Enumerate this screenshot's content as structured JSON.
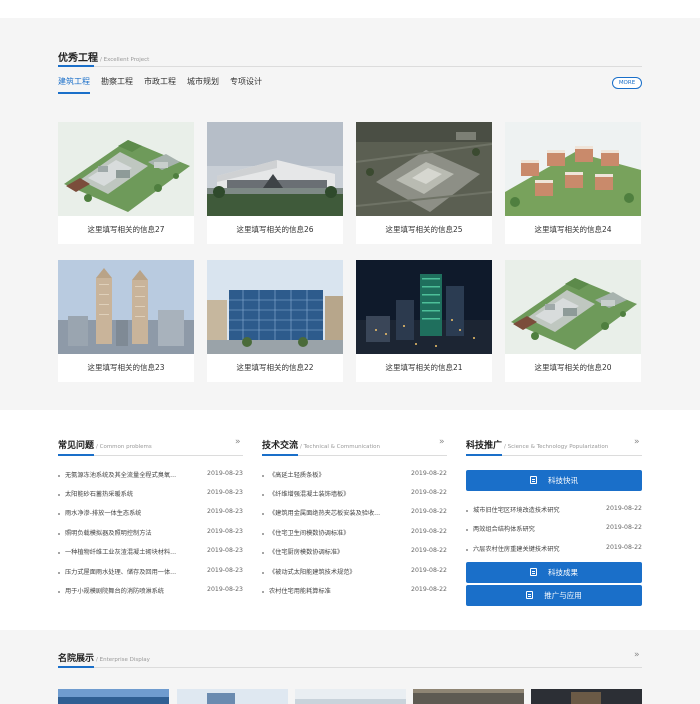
{
  "excellent": {
    "title": "优秀工程",
    "subtitle": "/ Excellent Project",
    "tabs": [
      "建筑工程",
      "勘察工程",
      "市政工程",
      "城市规划",
      "专项设计"
    ],
    "more_label": "MORE",
    "cards": [
      {
        "caption": "这里填写相关的信息27",
        "image": "campus-aerial"
      },
      {
        "caption": "这里填写相关的信息26",
        "image": "modern-building-lake"
      },
      {
        "caption": "这里填写相关的信息25",
        "image": "site-aerial"
      },
      {
        "caption": "这里填写相关的信息24",
        "image": "residential-aerial"
      },
      {
        "caption": "这里填写相关的信息23",
        "image": "twin-towers"
      },
      {
        "caption": "这里填写相关的信息22",
        "image": "glass-office"
      },
      {
        "caption": "这里填写相关的信息21",
        "image": "night-towers"
      },
      {
        "caption": "这里填写相关的信息20",
        "image": "campus-aerial"
      }
    ]
  },
  "faq": {
    "title": "常见问题",
    "subtitle": "/ Common problems",
    "items": [
      {
        "text": "无氨源冻池系统及其全流量全程式臭氧...",
        "date": "2019-08-23"
      },
      {
        "text": "太阳能砂石蓄热采暖系统",
        "date": "2019-08-23"
      },
      {
        "text": "雨水净渗-排放一体生态系统",
        "date": "2019-08-23"
      },
      {
        "text": "照明负载模拟器及照明控制方法",
        "date": "2019-08-23"
      },
      {
        "text": "一种植物纤维工业灰渣混凝土砌块材料...",
        "date": "2019-08-23"
      },
      {
        "text": "压力式屋面雨水处理、储存及回用一体...",
        "date": "2019-08-23"
      },
      {
        "text": "用于小规模剧院舞台的消防喷淋系统",
        "date": "2019-08-23"
      }
    ]
  },
  "tech": {
    "title": "技术交流",
    "subtitle": "/ Technical & Communication",
    "items": [
      {
        "text": "《高延土轻质条板》",
        "date": "2019-08-22"
      },
      {
        "text": "《纤维增强混凝土装饰墙板》",
        "date": "2019-08-22"
      },
      {
        "text": "《建筑用金属面绝热夹芯板安装及验收...",
        "date": "2019-08-22"
      },
      {
        "text": "《住宅卫生间模数协调标准》",
        "date": "2019-08-22"
      },
      {
        "text": "《住宅厨房模数协调标准》",
        "date": "2019-08-22"
      },
      {
        "text": "《被动式太阳能建筑技术规范》",
        "date": "2019-08-22"
      },
      {
        "text": "农村住宅用能耗算标准",
        "date": "2019-08-22"
      }
    ]
  },
  "popular": {
    "title": "科技推广",
    "subtitle": "/ Science & Technology Popularization",
    "btn_news": "科技快讯",
    "items": [
      {
        "text": "城市旧住宅区环境改造技术研究",
        "date": "2019-08-22"
      },
      {
        "text": "两效组合结构体系研究",
        "date": "2019-08-22"
      },
      {
        "text": "六层农村住房重建关键技术研究",
        "date": "2019-08-22"
      }
    ],
    "btn_results": "科技成果",
    "btn_apply": "推广与应用"
  },
  "enterprise": {
    "title": "名院展示",
    "subtitle": "/ Enterprise Display"
  },
  "icons": {
    "arrow": "»",
    "doc": "document-icon"
  },
  "colors": {
    "accent": "#1a6fc9",
    "bg_gray": "#f5f5f5"
  }
}
